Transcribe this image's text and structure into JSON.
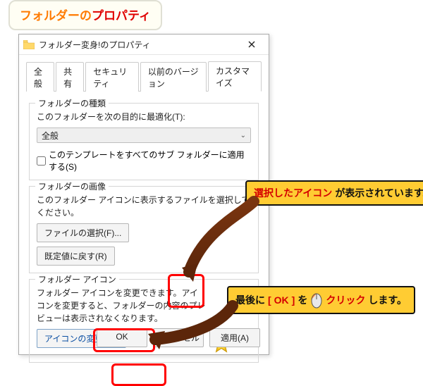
{
  "bubble": {
    "part1": "フォルダー",
    "part2": "の",
    "part3": "プロパティ"
  },
  "dialog": {
    "title": "フォルダー変身!のプロパティ",
    "tabs": [
      "全般",
      "共有",
      "セキュリティ",
      "以前のバージョン",
      "カスタマイズ"
    ],
    "active_tab": 4,
    "group1": {
      "legend": "フォルダーの種類",
      "desc": "このフォルダーを次の目的に最適化(T):",
      "select_value": "全般",
      "checkbox_label": "このテンプレートをすべてのサブ フォルダーに適用する(S)"
    },
    "group2": {
      "legend": "フォルダーの画像",
      "desc": "このフォルダー アイコンに表示するファイルを選択してください。",
      "btn_choose": "ファイルの選択(F)...",
      "btn_reset": "既定値に戻す(R)"
    },
    "group3": {
      "legend": "フォルダー アイコン",
      "desc": "フォルダー アイコンを変更できます。アイコンを変更すると、フォルダーの内容のプレビューは表示されなくなります。",
      "btn_change": "アイコンの変更(I)..."
    },
    "footer": {
      "ok": "OK",
      "cancel": "キャンセル",
      "apply": "適用(A)"
    }
  },
  "callouts": {
    "c1": {
      "red": "選択したアイコン",
      "rest": "が表示されています。"
    },
    "c2": {
      "pre": "最後に",
      "bracket_l": " [ ",
      "ok": "OK",
      "bracket_r": " ] ",
      "mid": "を",
      "click": "クリック",
      "post": "します。"
    }
  }
}
